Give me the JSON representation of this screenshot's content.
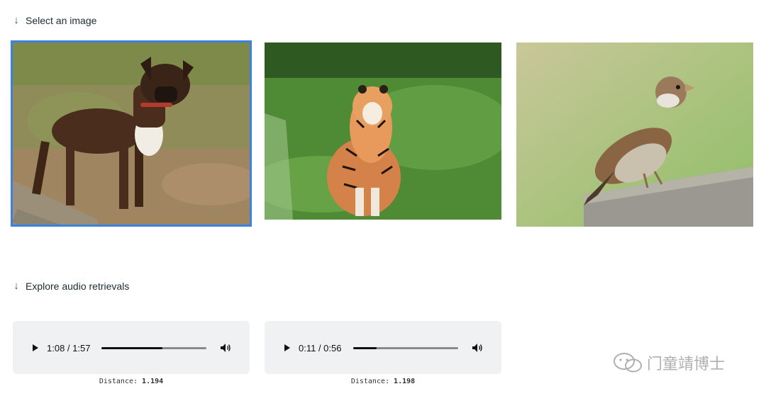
{
  "sections": {
    "select_image_label": "Select an image",
    "explore_audio_label": "Explore audio retrievals"
  },
  "images": [
    {
      "name": "boxer-dog",
      "selected": true
    },
    {
      "name": "tiger",
      "selected": false
    },
    {
      "name": "sparrow",
      "selected": false
    }
  ],
  "audio": [
    {
      "time": "1:08 / 1:57",
      "progress": 0.58,
      "distance_label": "Distance:",
      "distance_value": "1.194"
    },
    {
      "time": "0:11 / 0:56",
      "progress": 0.22,
      "distance_label": "Distance:",
      "distance_value": "1.198"
    }
  ],
  "icons": {
    "arrow": "arrow-down-icon",
    "play": "play-icon",
    "volume": "volume-icon"
  },
  "colors": {
    "selection_border": "#3b82e0",
    "player_bg": "#f0f1f3"
  },
  "watermark": "门童靖博士"
}
